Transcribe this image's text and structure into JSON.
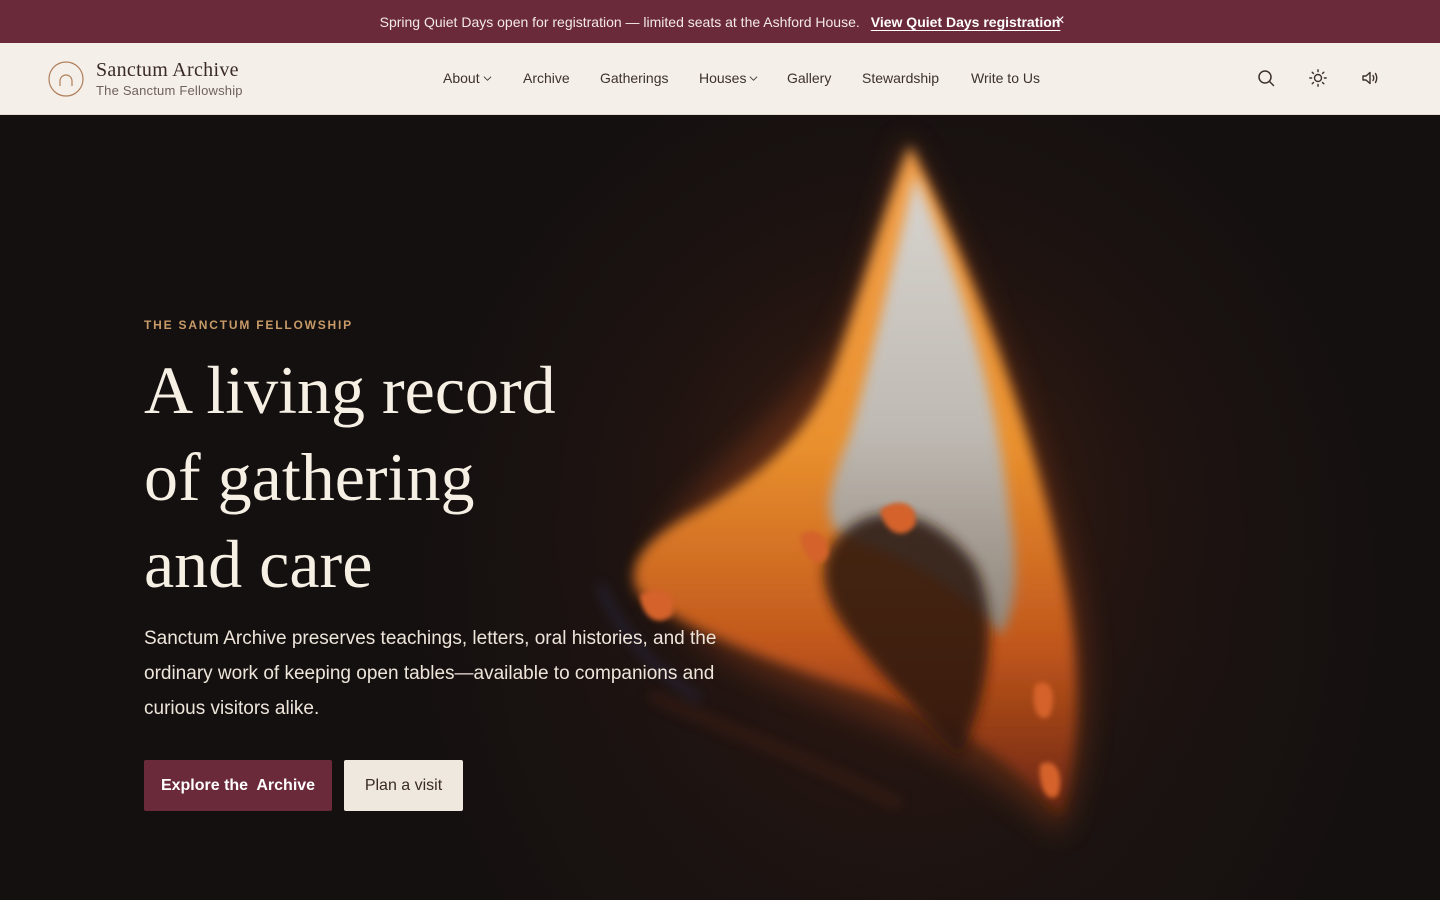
{
  "announcement": {
    "message": "Spring Quiet Days open for registration — limited seats at the Ashford House.",
    "link_label": "View Quiet Days registration",
    "close_glyph": "×"
  },
  "brand": {
    "name": "Sanctum Archive",
    "subtitle": "The Sanctum Fellowship",
    "logo_icon": "arch-circle-icon"
  },
  "nav": {
    "items": [
      {
        "label": "About",
        "has_dropdown": true
      },
      {
        "label": "Archive",
        "has_dropdown": false
      },
      {
        "label": "Gatherings",
        "has_dropdown": false
      },
      {
        "label": "Houses",
        "has_dropdown": true
      },
      {
        "label": "Gallery",
        "has_dropdown": false
      },
      {
        "label": "Stewardship",
        "has_dropdown": false
      },
      {
        "label": "Write to Us",
        "has_dropdown": false
      }
    ]
  },
  "header_icons": [
    "search-icon",
    "sun-icon",
    "speaker-icon"
  ],
  "hero": {
    "eyebrow": "THE SANCTUM FELLOWSHIP",
    "headline_line1": "A living record",
    "headline_line2": "of gathering",
    "headline_line3": "and care",
    "lede": "Sanctum Archive preserves teachings, letters, oral histories, and the ordinary work of keeping open tables—available to companions and curious visitors alike.",
    "primary_cta": "Explore the  Archive",
    "secondary_cta": "Plan a visit"
  },
  "colors": {
    "accent": "#6b2a3a",
    "header_bg": "#f4efe8",
    "eyebrow": "#c79a67",
    "hero_bg": "#161110"
  }
}
